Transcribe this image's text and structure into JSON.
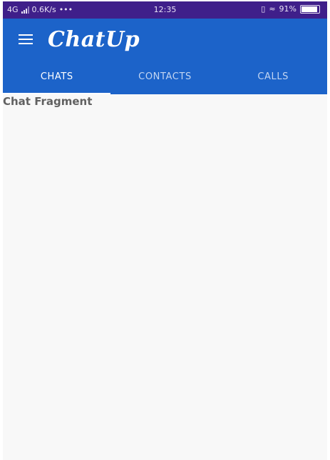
{
  "status_bar": {
    "network": "4G",
    "speed": "0.6K/s",
    "dots": "•••",
    "time": "12:35",
    "battery": "91%",
    "icons": [
      "signal-icon",
      "vibrate-icon",
      "wifi-icon",
      "battery-icon"
    ]
  },
  "toolbar": {
    "title": "ChatUp",
    "menu_icon": "menu-icon"
  },
  "tabs": [
    {
      "label": "CHATS",
      "active": true
    },
    {
      "label": "CONTACTS",
      "active": false
    },
    {
      "label": "CALLS",
      "active": false
    }
  ],
  "content": {
    "text": "Chat Fragment"
  },
  "colors": {
    "status_bar": "#3f1f8a",
    "app_bar": "#1c63c9",
    "tab_inactive": "#c3d6f2",
    "background": "#f8f8f8"
  }
}
